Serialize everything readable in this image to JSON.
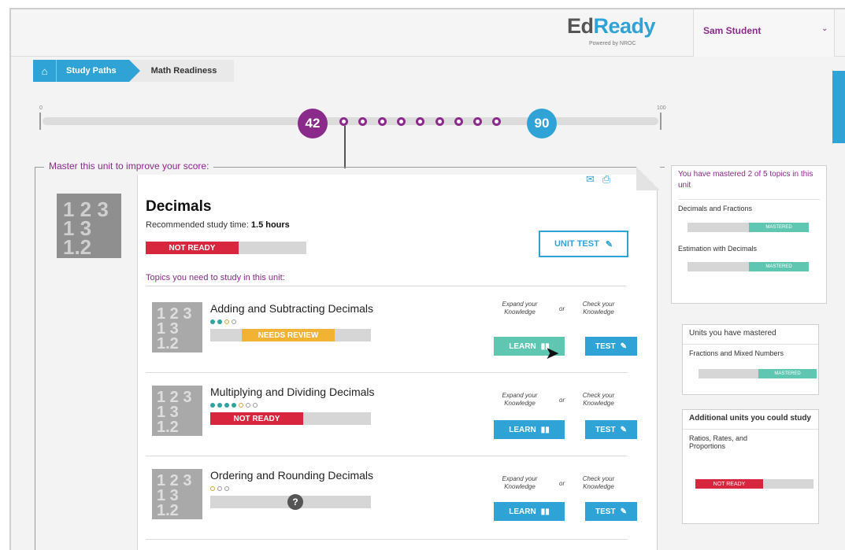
{
  "header": {
    "logo_main_a": "Ed",
    "logo_main_b": "Ready",
    "logo_sub": "Powered by NROC",
    "user_name": "Sam Student",
    "user_caret": "⌄"
  },
  "breadcrumb": {
    "home_icon": "⌂",
    "paths": "Study Paths",
    "current": "Math Readiness"
  },
  "score_track": {
    "min": "0",
    "max": "100",
    "current": "42",
    "goal": "90",
    "milestone_count": 9
  },
  "unit_panel": {
    "legend": "Master this unit to improve your score:",
    "thumb": "1 2 3\n1 3\n1.2",
    "title": "Decimals",
    "study_prefix": "Recommended study time: ",
    "study_time": "1.5 hours",
    "status": "NOT READY",
    "unit_test": "UNIT TEST",
    "unit_test_icon": "✎",
    "mail_icon": "✉",
    "print_icon": "⎙",
    "topics_heading": "Topics you need to study in this unit:"
  },
  "labels": {
    "expand": "Expand your Knowledge",
    "or": "or",
    "check": "Check your Knowledge",
    "learn": "LEARN",
    "learn_icon": "▮▮",
    "test": "TEST",
    "test_icon": "✎"
  },
  "topics": [
    {
      "title": "Adding and Subtracting Decimals",
      "status": "NEEDS REVIEW",
      "mastery_dots": 4,
      "mastery_filled": 2
    },
    {
      "title": "Multiplying and Dividing Decimals",
      "status": "NOT READY",
      "mastery_dots": 7,
      "mastery_filled": 4
    },
    {
      "title": "Ordering and Rounding Decimals",
      "status": "?",
      "mastery_dots": 3,
      "mastery_filled": 0
    }
  ],
  "right": {
    "mastered_topics_heading": "You have mastered 2 of 5 topics in this unit",
    "mastered_topics": [
      {
        "name": "Decimals and Fractions",
        "status": "MASTERED"
      },
      {
        "name": "Estimation with Decimals",
        "status": "MASTERED"
      }
    ],
    "units_mastered_heading": "Units you have mastered",
    "units_mastered": [
      {
        "name": "Fractions and Mixed Numbers",
        "status": "MASTERED"
      }
    ],
    "additional_heading": "Additional units you could study",
    "additional": [
      {
        "name": "Ratios, Rates, and Proportions",
        "status": "NOT READY"
      }
    ]
  },
  "colors": {
    "purple": "#8a2a8a",
    "blue": "#2fa3d6",
    "teal": "#5fc7b1",
    "red": "#d7263d",
    "gold": "#f2b233"
  }
}
